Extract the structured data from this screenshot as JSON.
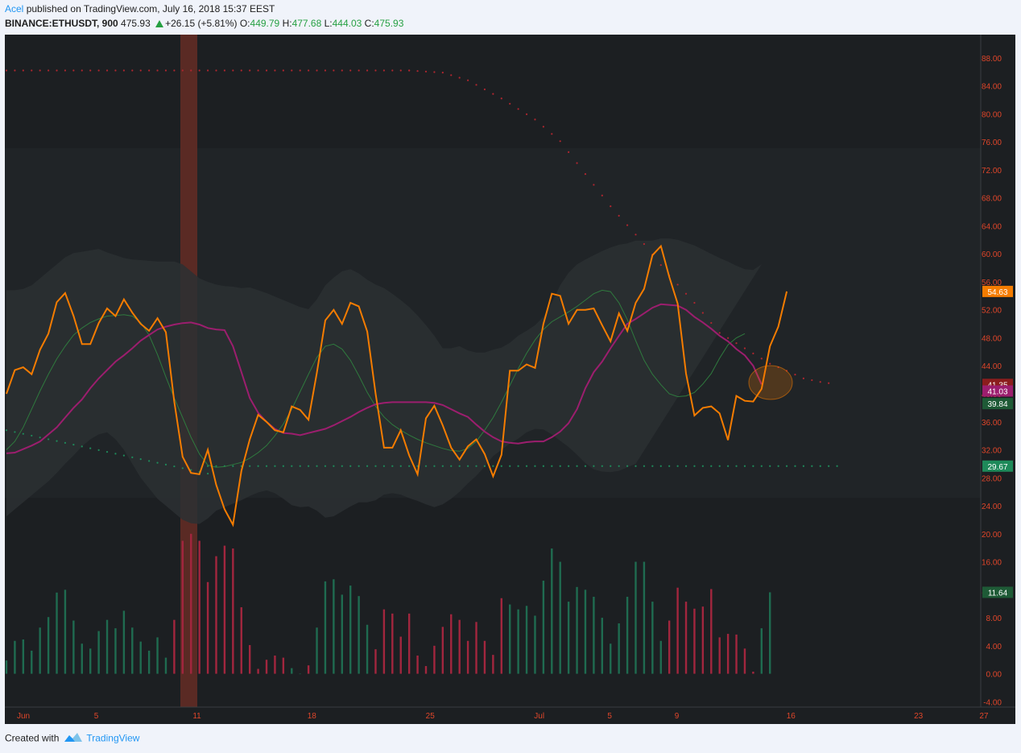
{
  "header": {
    "author": "Acel",
    "published": "published on TradingView.com, July 16, 2018 15:37 EEST",
    "symbol": "BINANCE:ETHUSDT, 900",
    "last": "475.93",
    "change": "+26.15 (+5.81%)",
    "o_label": "O:",
    "o": "449.79",
    "h_label": "H:",
    "h": "477.68",
    "l_label": "L:",
    "l": "444.03",
    "c_label": "C:",
    "c": "475.93"
  },
  "footer": {
    "created": "Created with",
    "brand": "TradingView"
  },
  "colors": {
    "background": "#1c1f22",
    "rsi": "#f57c00",
    "rsi_ma": "#9c1e6e",
    "basis": "#2f7a3e",
    "psar_high": "#b0262f",
    "psar_low": "#1e8a5a",
    "vol_up": "#1f6b50",
    "vol_down": "#a2263e",
    "axis_text": "#e0462a",
    "highlight": "#5a2a24"
  },
  "chart_data": {
    "type": "line",
    "title": "",
    "y_axis_ticks": [
      "88.00",
      "84.00",
      "80.00",
      "76.00",
      "72.00",
      "68.00",
      "64.00",
      "60.00",
      "56.00",
      "52.00",
      "48.00",
      "44.00",
      "40.00",
      "36.00",
      "32.00",
      "28.00",
      "24.00",
      "20.00",
      "16.00",
      "12.00",
      "8.00",
      "4.00",
      "0.00",
      "-4.00"
    ],
    "ylim": [
      -4,
      88
    ],
    "x_axis_ticks": [
      "Jun",
      "5",
      "11",
      "18",
      "25",
      "Jul",
      "5",
      "9",
      "16",
      "23",
      "27"
    ],
    "x_index_range": [
      0,
      111
    ],
    "grid": false,
    "price_labels": [
      {
        "text": "54.63",
        "value": 54.63,
        "color": "#f57c00"
      },
      {
        "text": "41.35",
        "value": 41.35,
        "color": "#8b1d1d"
      },
      {
        "text": "41.03",
        "value": 40.4,
        "color": "#9c1e6e"
      },
      {
        "text": "39.84",
        "value": 38.6,
        "color": "#1e5a36"
      },
      {
        "text": "29.67",
        "value": 29.67,
        "color": "#1e8a5a"
      },
      {
        "text": "11.64",
        "value": 11.64,
        "color": "#1e5a36"
      }
    ],
    "series": [
      {
        "values": [
          40,
          43.4,
          43.8,
          42.8,
          46.3,
          48.6,
          53.1,
          54.4,
          51.1,
          47.1,
          47.1,
          50.1,
          52.2,
          51.1,
          53.5,
          51.6,
          50,
          49,
          50.8,
          48.8,
          38.9,
          31,
          28.7,
          28.5,
          32,
          27,
          23.5,
          21.3,
          29,
          33.5,
          37,
          36,
          34.8,
          34.5,
          38.2,
          37.7,
          36.3,
          43,
          50.5,
          52,
          50,
          53,
          52.5,
          48.9,
          40,
          32.3,
          32.3,
          34.8,
          31.2,
          28.5,
          36.5,
          38.3,
          35.5,
          32.3,
          30.6,
          32.5,
          33.5,
          31.4,
          28.2,
          31.3,
          43.3,
          43.3,
          44.2,
          43.7,
          50,
          54.3,
          54,
          50,
          52,
          52,
          52.2,
          49.8,
          47.5,
          51.5,
          49,
          53,
          55,
          59.8,
          61.1,
          56.7,
          52.9,
          42.9,
          36.9,
          38,
          38.2,
          37.2,
          33.4,
          39.7,
          39,
          38.9,
          40.7,
          46.8,
          49.6,
          54.63
        ]
      },
      {
        "values": [
          31.5,
          31.6,
          32.1,
          32.6,
          33.2,
          34.2,
          35.2,
          36.6,
          38,
          39.2,
          40.8,
          42.2,
          43.4,
          44.6,
          45.5,
          46.5,
          47.6,
          48.4,
          49.2,
          49.6,
          49.9,
          50.1,
          50.2,
          49.9,
          49.4,
          49.2,
          49.1,
          46.8,
          43.1,
          39.4,
          37.3,
          36,
          35,
          34.4,
          34.3,
          34.1,
          34.4,
          34.7,
          35,
          35.5,
          36.1,
          36.7,
          37.4,
          38,
          38.5,
          38.7,
          38.8,
          38.8,
          38.8,
          38.8,
          38.8,
          38.7,
          38.4,
          37.8,
          37.2,
          36.7,
          35.6,
          34.6,
          33.8,
          33.2,
          33,
          32.9,
          33.1,
          33.2,
          33.2,
          33.8,
          34.6,
          35.8,
          37.8,
          40.8,
          43.1,
          44.6,
          46.5,
          48.3,
          50,
          50.7,
          51.5,
          52.3,
          52.8,
          52.7,
          52.6,
          52,
          51,
          50.2,
          49.3,
          48.3,
          47.5,
          46.4,
          45.5,
          44,
          41.35
        ]
      },
      {
        "values": [
          32,
          33.2,
          35.2,
          37.8,
          40.4,
          42.8,
          45,
          46.8,
          48.4,
          49.4,
          50.2,
          50.7,
          51.1,
          51.2,
          51.3,
          51.1,
          50.2,
          48.4,
          45.6,
          42.4,
          39.4,
          36.6,
          33.8,
          31.4,
          29.8,
          29.5,
          29.6,
          29.9,
          30.2,
          30.8,
          31.6,
          32.6,
          34,
          35.7,
          37.8,
          40.3,
          42.8,
          45.2,
          46.8,
          47.1,
          46.4,
          44.8,
          42.6,
          40.2,
          38.2,
          36.7,
          35.6,
          34.8,
          34.1,
          33.5,
          33,
          32.6,
          32.2,
          31.9,
          31.8,
          32.2,
          33.2,
          34.8,
          36.6,
          38.8,
          41.2,
          43.6,
          45.8,
          47.7,
          49.2,
          50.3,
          51,
          51.7,
          52.5,
          53.4,
          54.3,
          54.8,
          54.6,
          53,
          50.6,
          47.6,
          44.8,
          42.8,
          41.3,
          40,
          39.6,
          39.7,
          40.2,
          41.4,
          42.9,
          45.1,
          47,
          48,
          48.6
        ]
      }
    ],
    "psar": [
      {
        "start": 0,
        "end": 48,
        "level": 86.2
      },
      {
        "curve": [
          [
            48,
            86.2
          ],
          [
            52,
            85.9
          ],
          [
            55,
            84.8
          ],
          [
            59,
            82.2
          ],
          [
            63,
            79.2
          ],
          [
            66,
            76.1
          ],
          [
            69,
            71.4
          ],
          [
            72,
            66.8
          ],
          [
            76,
            61.4
          ],
          [
            79,
            56.9
          ],
          [
            82,
            53
          ],
          [
            85,
            48.7
          ],
          [
            88,
            46.5
          ],
          [
            91,
            44.3
          ],
          [
            93,
            43.3
          ],
          [
            95,
            42.2
          ],
          [
            97,
            41.7
          ],
          [
            99,
            41.35
          ]
        ]
      },
      {
        "start": 0,
        "end": 24,
        "from": 34.8,
        "to": 28.6,
        "dotted": true
      },
      {
        "start": 24,
        "end": 99,
        "level": 29.67
      }
    ],
    "bollinger": {
      "upper": [
        54.8,
        54.8,
        55,
        55.5,
        56.5,
        57.5,
        58.5,
        59.5,
        60.1,
        60.3,
        60.5,
        60.7,
        60.2,
        59.8,
        59.4,
        59.2,
        59.1,
        59,
        58.9,
        58.9,
        58.9,
        58.5,
        57.5,
        56.5,
        56,
        55.6,
        55.4,
        55.3,
        55.1,
        55.2,
        54.8,
        54.4,
        53.9,
        53.4,
        52.9,
        52.4,
        52.1,
        53.5,
        55.5,
        56.6,
        57.5,
        57.8,
        57.2,
        56.3,
        55.6,
        55.1,
        54.3,
        53.4,
        52.4,
        51.2,
        49.8,
        48.3,
        46.5,
        46.5,
        46.8,
        46.2,
        45.9,
        45.9,
        46.3,
        46.6,
        47.3,
        48.3,
        49,
        49.8,
        51,
        53,
        55.5,
        57.3,
        58.5,
        59.2,
        59.8,
        60.4,
        60.9,
        61.3,
        61.5,
        61.9,
        61.9,
        61.9,
        62.2,
        62.2,
        62,
        61.6,
        61.2,
        60.6,
        60,
        59.4,
        58.9,
        58.3,
        57.8,
        57.7,
        58.5
      ],
      "lower": [
        22.5,
        23.5,
        24.5,
        25.5,
        26.5,
        27.5,
        28.7,
        30,
        31.2,
        32.5,
        33.5,
        34.2,
        34.5,
        33.5,
        32,
        30,
        28,
        26.5,
        25,
        24,
        23,
        22,
        21.5,
        21.4,
        22.2,
        23.3,
        23.8,
        24.3,
        24.8,
        25.4,
        25.9,
        26.2,
        25.8,
        25,
        24.1,
        23.8,
        23.9,
        23.3,
        22.3,
        22.5,
        23.2,
        23.9,
        24.5,
        24.5,
        24.8,
        25.6,
        25.8,
        25.6,
        25.1,
        24.7,
        24.2,
        23.8,
        24.2,
        25,
        26,
        27.2,
        28.3,
        29.6,
        31.1,
        32,
        32.9,
        33.6,
        34.5,
        35,
        34.9,
        34.2,
        33.3,
        32.4,
        31.3,
        30.1,
        29.2,
        28.9,
        28.8,
        29,
        29.5,
        30
      ]
    },
    "volume": [
      {
        "v": 1.9,
        "up": true
      },
      {
        "v": 4.7,
        "up": true
      },
      {
        "v": 4.9,
        "up": true
      },
      {
        "v": 3.3,
        "up": true
      },
      {
        "v": 6.6,
        "up": true
      },
      {
        "v": 8.1,
        "up": true
      },
      {
        "v": 11.6,
        "up": true
      },
      {
        "v": 12,
        "up": true
      },
      {
        "v": 7.6,
        "up": true
      },
      {
        "v": 4.3,
        "up": true
      },
      {
        "v": 3.6,
        "up": true
      },
      {
        "v": 6.1,
        "up": true
      },
      {
        "v": 7.7,
        "up": true
      },
      {
        "v": 6.5,
        "up": true
      },
      {
        "v": 9,
        "up": true
      },
      {
        "v": 6.6,
        "up": true
      },
      {
        "v": 4.6,
        "up": true
      },
      {
        "v": 3.3,
        "up": true
      },
      {
        "v": 5.2,
        "up": true
      },
      {
        "v": 2.3,
        "up": true
      },
      {
        "v": 7.7,
        "up": false
      },
      {
        "v": 19,
        "up": false
      },
      {
        "v": 20,
        "up": false
      },
      {
        "v": 19,
        "up": false
      },
      {
        "v": 13.1,
        "up": false
      },
      {
        "v": 16.8,
        "up": false
      },
      {
        "v": 18.3,
        "up": false
      },
      {
        "v": 17.9,
        "up": false
      },
      {
        "v": 9.5,
        "up": false
      },
      {
        "v": 4.1,
        "up": false
      },
      {
        "v": 0.7,
        "up": false
      },
      {
        "v": 2,
        "up": false
      },
      {
        "v": 2.6,
        "up": false
      },
      {
        "v": 2.3,
        "up": false
      },
      {
        "v": 0.8,
        "up": true
      },
      {
        "v": 0,
        "up": true
      },
      {
        "v": 1.2,
        "up": false
      },
      {
        "v": 6.6,
        "up": true
      },
      {
        "v": 13.2,
        "up": true
      },
      {
        "v": 13.5,
        "up": true
      },
      {
        "v": 11.3,
        "up": true
      },
      {
        "v": 12.6,
        "up": true
      },
      {
        "v": 11.1,
        "up": true
      },
      {
        "v": 7,
        "up": true
      },
      {
        "v": 3.5,
        "up": false
      },
      {
        "v": 9.2,
        "up": false
      },
      {
        "v": 8.6,
        "up": false
      },
      {
        "v": 5.3,
        "up": false
      },
      {
        "v": 8.6,
        "up": false
      },
      {
        "v": 2.6,
        "up": false
      },
      {
        "v": 1.1,
        "up": false
      },
      {
        "v": 4,
        "up": false
      },
      {
        "v": 6.7,
        "up": false
      },
      {
        "v": 8.5,
        "up": false
      },
      {
        "v": 7.7,
        "up": false
      },
      {
        "v": 4.7,
        "up": false
      },
      {
        "v": 7.4,
        "up": false
      },
      {
        "v": 4.7,
        "up": false
      },
      {
        "v": 2.7,
        "up": false
      },
      {
        "v": 10.8,
        "up": false
      },
      {
        "v": 9.9,
        "up": true
      },
      {
        "v": 9.2,
        "up": true
      },
      {
        "v": 9.7,
        "up": true
      },
      {
        "v": 8.3,
        "up": true
      },
      {
        "v": 13.3,
        "up": true
      },
      {
        "v": 17.9,
        "up": true
      },
      {
        "v": 16,
        "up": true
      },
      {
        "v": 10.3,
        "up": true
      },
      {
        "v": 12.4,
        "up": true
      },
      {
        "v": 12,
        "up": true
      },
      {
        "v": 11,
        "up": true
      },
      {
        "v": 8,
        "up": true
      },
      {
        "v": 4.3,
        "up": true
      },
      {
        "v": 7.2,
        "up": true
      },
      {
        "v": 11,
        "up": true
      },
      {
        "v": 16,
        "up": true
      },
      {
        "v": 16,
        "up": true
      },
      {
        "v": 10.3,
        "up": true
      },
      {
        "v": 4.7,
        "up": true
      },
      {
        "v": 7.6,
        "up": false
      },
      {
        "v": 12.3,
        "up": false
      },
      {
        "v": 10.3,
        "up": false
      },
      {
        "v": 9.3,
        "up": false
      },
      {
        "v": 9.6,
        "up": false
      },
      {
        "v": 12.1,
        "up": false
      },
      {
        "v": 5.2,
        "up": false
      },
      {
        "v": 5.7,
        "up": false
      },
      {
        "v": 5.6,
        "up": false
      },
      {
        "v": 3.6,
        "up": false
      },
      {
        "v": 0.3,
        "up": false
      },
      {
        "v": 6.5,
        "up": true
      },
      {
        "v": 11.64,
        "up": true
      }
    ]
  }
}
